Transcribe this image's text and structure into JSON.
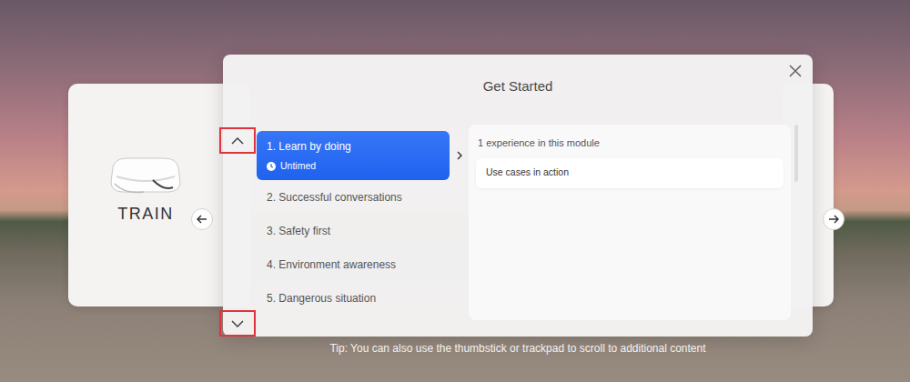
{
  "background_card": {
    "title": "TRAIN"
  },
  "modal": {
    "title": "Get Started"
  },
  "scroll_buttons": [
    {
      "kind": "up",
      "highlighted": true
    },
    {
      "kind": "down",
      "highlighted": true
    }
  ],
  "modules": [
    {
      "label": "1. Learn by doing",
      "badge": "Untimed",
      "selected": true
    },
    {
      "label": "2. Successful conversations",
      "selected": false
    },
    {
      "label": "3. Safety first",
      "selected": false
    },
    {
      "label": "4. Environment awareness",
      "selected": false
    },
    {
      "label": "5. Dangerous situation",
      "selected": false
    }
  ],
  "detail": {
    "count": "1 experience in this module",
    "experiences": [
      "Use cases in action"
    ]
  },
  "tip": "Tip: You can also use the thumbstick or trackpad to scroll to additional content"
}
